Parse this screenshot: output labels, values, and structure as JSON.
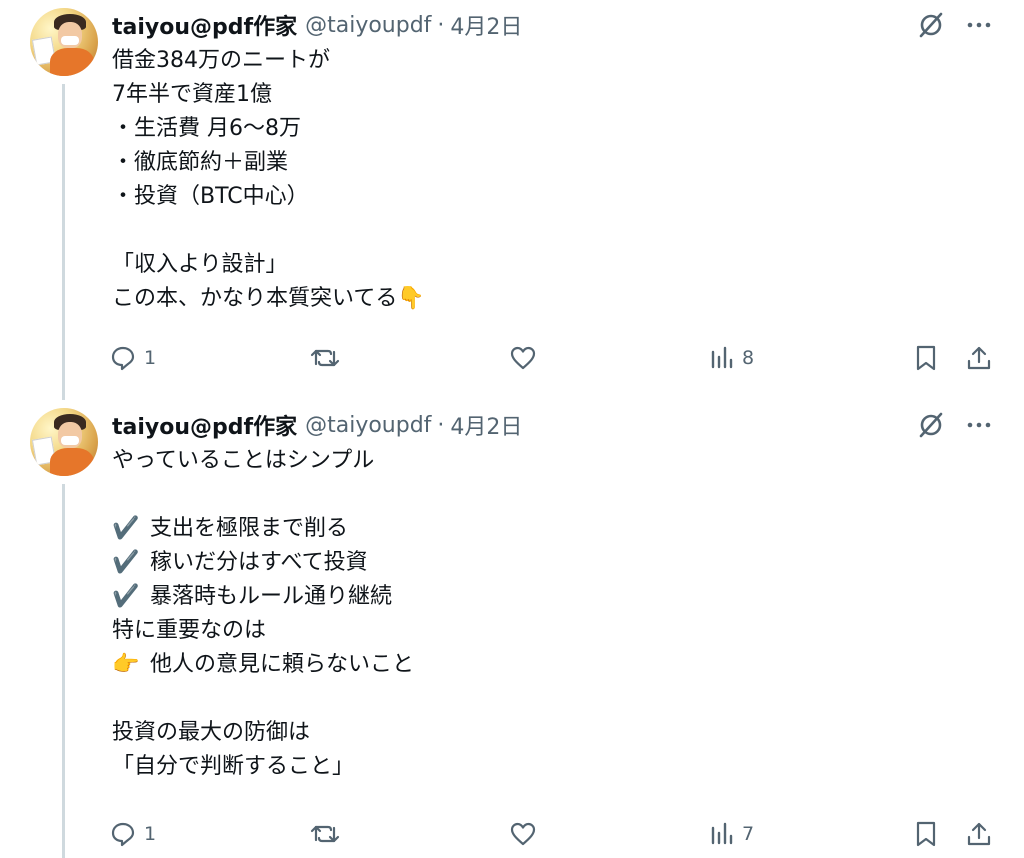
{
  "tweets": [
    {
      "author_name": "taiyou@pdf作家",
      "handle": "@taiyoupdf",
      "separator": "·",
      "date": "4月2日",
      "lines": [
        "借金384万のニートが",
        "7年半で資産1億",
        "・生活費 月6〜8万",
        "・徹底節約＋副業",
        "・投資（BTC中心）",
        "",
        "「収入より設計」",
        "この本、かなり本質突いてる👇"
      ],
      "replies": "1",
      "reposts": "",
      "likes": "",
      "views": "8"
    },
    {
      "author_name": "taiyou@pdf作家",
      "handle": "@taiyoupdf",
      "separator": "·",
      "date": "4月2日",
      "lines": [
        "やっていることはシンプル",
        "",
        "支出を極限まで削る",
        "稼いだ分はすべて投資",
        "暴落時もルール通り継続",
        "特に重要なのは",
        "他人の意見に頼らないこと",
        "",
        "投資の最大の防御は",
        "「自分で判断すること」"
      ],
      "line_markers": [
        "",
        "",
        "check",
        "check",
        "check",
        "",
        "point",
        "",
        "",
        ""
      ],
      "replies": "1",
      "reposts": "",
      "likes": "",
      "views": "7"
    }
  ],
  "icons": {
    "reply": "reply-icon",
    "repost": "repost-icon",
    "like": "heart-icon",
    "views": "views-icon",
    "bookmark": "bookmark-icon",
    "share": "share-icon",
    "grok": "grok-icon",
    "more": "more-icon",
    "check_marker": "✔️",
    "point_marker": "👉"
  },
  "colors": {
    "text": "#0f1419",
    "secondary": "#536471",
    "thread_line": "#cfd9de"
  }
}
